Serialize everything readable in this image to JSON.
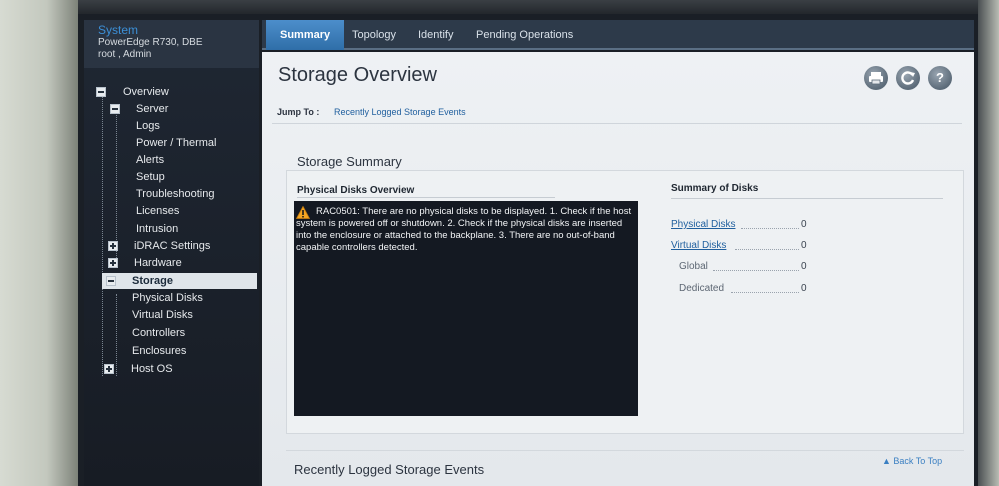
{
  "sidebar": {
    "system_title": "System",
    "server_model": "PowerEdge R730, DBE",
    "user": "root , Admin",
    "items": [
      {
        "label": "Overview"
      },
      {
        "label": "Server"
      },
      {
        "label": "Logs"
      },
      {
        "label": "Power / Thermal"
      },
      {
        "label": "Alerts"
      },
      {
        "label": "Setup"
      },
      {
        "label": "Troubleshooting"
      },
      {
        "label": "Licenses"
      },
      {
        "label": "Intrusion"
      },
      {
        "label": "iDRAC Settings"
      },
      {
        "label": "Hardware"
      },
      {
        "label": "Storage"
      },
      {
        "label": "Physical Disks"
      },
      {
        "label": "Virtual Disks"
      },
      {
        "label": "Controllers"
      },
      {
        "label": "Enclosures"
      },
      {
        "label": "Host OS"
      }
    ]
  },
  "tabs": [
    {
      "label": "Summary"
    },
    {
      "label": "Topology"
    },
    {
      "label": "Identify"
    },
    {
      "label": "Pending Operations"
    }
  ],
  "main": {
    "title": "Storage Overview",
    "jump_to_label": "Jump To :",
    "jump_link": "Recently Logged Storage Events",
    "toolbar_icons": [
      "print-icon",
      "refresh-icon",
      "help-icon"
    ],
    "storage_summary": {
      "title": "Storage Summary",
      "physical_disks_overview_title": "Physical Disks Overview",
      "message": "RAC0501: There are no physical disks to be displayed. 1. Check if the host system is powered off or shutdown. 2. Check if the physical disks are inserted into the enclosure or attached to the backplane. 3. There are no out-of-band capable controllers detected.",
      "summary_of_disks_title": "Summary of Disks",
      "rows": [
        {
          "label": "Physical Disks",
          "value": "0"
        },
        {
          "label": "Virtual Disks",
          "value": "0"
        },
        {
          "label": "Global",
          "value": "0"
        },
        {
          "label": "Dedicated",
          "value": "0"
        }
      ]
    },
    "recent_events_title": "Recently Logged Storage Events",
    "back_to_top": "▲ Back To Top"
  },
  "colors": {
    "active_tab": "#2f6ea8",
    "link": "#1f5f9e",
    "nav_background": "#1f2733",
    "warning": "#f5a623"
  }
}
